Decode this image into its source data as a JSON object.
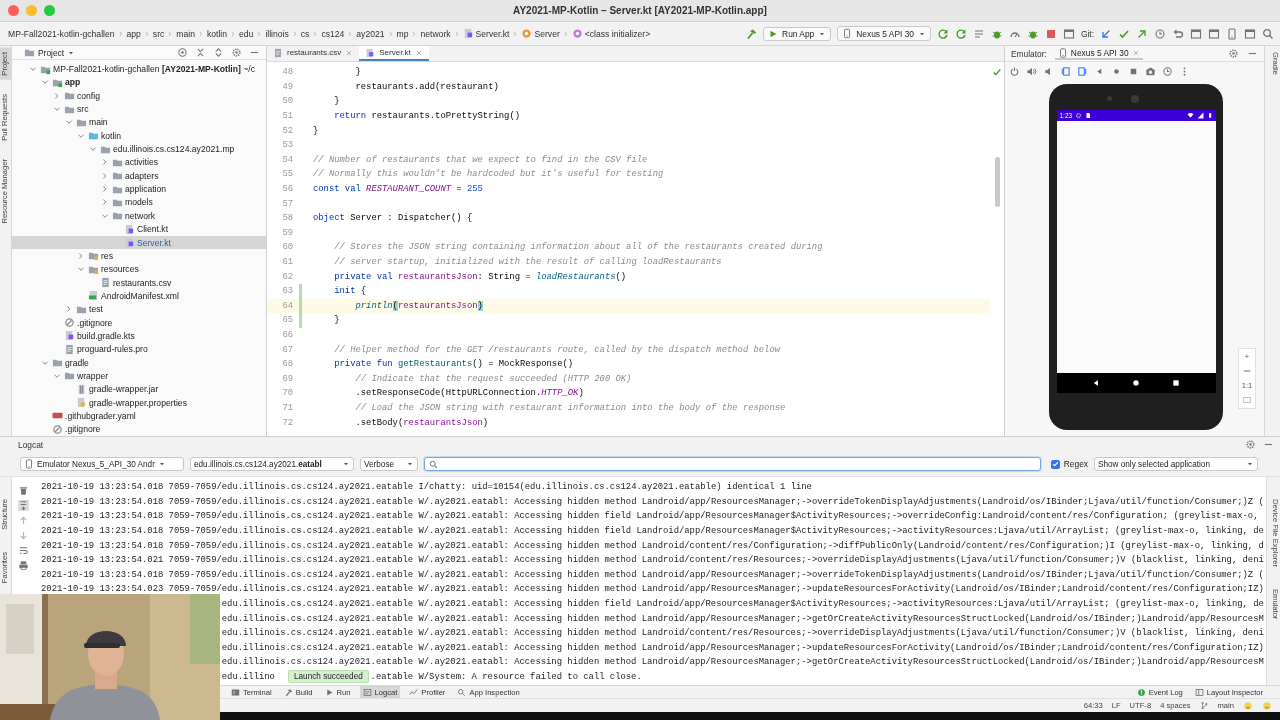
{
  "window": {
    "title": "AY2021-MP-Kotlin – Server.kt [AY2021-MP-Kotlin.app]"
  },
  "breadcrumbs": [
    {
      "label": "MP-Fall2021-kotlin-gchallen",
      "kind": "folder"
    },
    {
      "label": "app",
      "kind": "folder"
    },
    {
      "label": "src",
      "kind": "folder"
    },
    {
      "label": "main",
      "kind": "folder"
    },
    {
      "label": "kotlin",
      "kind": "folder"
    },
    {
      "label": "edu",
      "kind": "folder"
    },
    {
      "label": "illinois",
      "kind": "folder"
    },
    {
      "label": "cs",
      "kind": "folder"
    },
    {
      "label": "cs124",
      "kind": "folder"
    },
    {
      "label": "ay2021",
      "kind": "folder"
    },
    {
      "label": "mp",
      "kind": "folder"
    },
    {
      "label": "network",
      "kind": "folder"
    },
    {
      "label": "Server.kt",
      "kind": "file"
    },
    {
      "label": "Server",
      "kind": "class"
    },
    {
      "label": "<class initializer>",
      "kind": "method"
    }
  ],
  "toolbar": {
    "run_config": "Run App",
    "device": "Nexus 5 API 30",
    "git_label": "Git:"
  },
  "left_strip": [
    {
      "label": "Project",
      "selected": true
    },
    {
      "label": "Pull Requests",
      "selected": false
    },
    {
      "label": "Resource Manager",
      "selected": false
    }
  ],
  "project": {
    "view": "Project",
    "tree": [
      {
        "label": "MP-Fall2021-kotlin-gchallen **[AY2021-MP-Kotlin]** ~/c",
        "kind": "module",
        "expanded": true,
        "selected": false,
        "children": [
          {
            "label": "app",
            "kind": "module",
            "expanded": true,
            "selected": false,
            "children": [
              {
                "label": "config",
                "kind": "folder",
                "expanded": false,
                "selected": false
              },
              {
                "label": "src",
                "kind": "folder",
                "expanded": true,
                "selected": false,
                "children": [
                  {
                    "label": "main",
                    "kind": "folder",
                    "expanded": true,
                    "selected": false,
                    "children": [
                      {
                        "label": "kotlin",
                        "kind": "source",
                        "expanded": true,
                        "selected": false,
                        "children": [
                          {
                            "label": "edu.illinois.cs.cs124.ay2021.mp",
                            "kind": "folder",
                            "expanded": true,
                            "selected": false,
                            "children": [
                              {
                                "label": "activities",
                                "kind": "folder",
                                "expanded": false,
                                "selected": false
                              },
                              {
                                "label": "adapters",
                                "kind": "folder",
                                "expanded": false,
                                "selected": false
                              },
                              {
                                "label": "application",
                                "kind": "folder",
                                "expanded": false,
                                "selected": false
                              },
                              {
                                "label": "models",
                                "kind": "folder",
                                "expanded": false,
                                "selected": false
                              },
                              {
                                "label": "network",
                                "kind": "folder",
                                "expanded": true,
                                "selected": false,
                                "children": [
                                  {
                                    "label": "Client.kt",
                                    "kind": "kotlin",
                                    "selected": false
                                  },
                                  {
                                    "label": "Server.kt",
                                    "kind": "kotlin",
                                    "selected": true
                                  }
                                ]
                              }
                            ]
                          }
                        ]
                      },
                      {
                        "label": "res",
                        "kind": "resfolder",
                        "expanded": false,
                        "selected": false
                      },
                      {
                        "label": "resources",
                        "kind": "resfolder",
                        "expanded": true,
                        "selected": false,
                        "children": [
                          {
                            "label": "restaurants.csv",
                            "kind": "text",
                            "selected": false
                          }
                        ]
                      },
                      {
                        "label": "AndroidManifest.xml",
                        "kind": "manifest",
                        "selected": false
                      }
                    ]
                  },
                  {
                    "label": "test",
                    "kind": "folder",
                    "expanded": false,
                    "selected": false
                  }
                ]
              },
              {
                "label": ".gitignore",
                "kind": "ignore",
                "selected": false
              },
              {
                "label": "build.gradle.kts",
                "kind": "kotlin",
                "selected": false
              },
              {
                "label": "proguard-rules.pro",
                "kind": "text",
                "selected": false
              }
            ]
          },
          {
            "label": "gradle",
            "kind": "folder",
            "expanded": true,
            "selected": false,
            "children": [
              {
                "label": "wrapper",
                "kind": "folder",
                "expanded": true,
                "selected": false,
                "children": [
                  {
                    "label": "gradle-wrapper.jar",
                    "kind": "jar",
                    "selected": false
                  },
                  {
                    "label": "gradle-wrapper.properties",
                    "kind": "properties",
                    "selected": false
                  }
                ]
              }
            ]
          },
          {
            "label": ".githubgrader.yaml",
            "kind": "yaml",
            "selected": false
          },
          {
            "label": ".gitignore",
            "kind": "ignore",
            "selected": false
          }
        ]
      }
    ]
  },
  "editor": {
    "tabs": [
      {
        "label": "restaurants.csv",
        "kind": "text",
        "selected": false
      },
      {
        "label": "Server.kt",
        "kind": "kotlin",
        "selected": true
      }
    ],
    "lines": [
      {
        "n": "48",
        "code": [
          {
            "kind": "plain",
            "text": "        }"
          }
        ],
        "current": false,
        "changed": false
      },
      {
        "n": "49",
        "code": [
          {
            "kind": "plain",
            "text": "        restaurants.add(restaurant)"
          }
        ],
        "current": false,
        "changed": false
      },
      {
        "n": "50",
        "code": [
          {
            "kind": "plain",
            "text": "    }"
          }
        ],
        "current": false,
        "changed": false
      },
      {
        "n": "51",
        "code": [
          {
            "kind": "keyword",
            "text": "    return "
          },
          {
            "kind": "plain",
            "text": "restaurants.toPrettyString()"
          }
        ],
        "current": false,
        "changed": false
      },
      {
        "n": "52",
        "code": [
          {
            "kind": "plain",
            "text": "}"
          }
        ],
        "current": false,
        "changed": false
      },
      {
        "n": "53",
        "current": false,
        "changed": false
      },
      {
        "n": "54",
        "code": [
          {
            "kind": "comment",
            "text": "// Number of restaurants that we expect to find in the CSV file"
          }
        ],
        "current": false,
        "changed": false
      },
      {
        "n": "55",
        "code": [
          {
            "kind": "comment",
            "text": "// Normally this wouldn't be hardcoded but it's useful for testing"
          }
        ],
        "current": false,
        "changed": false
      },
      {
        "n": "56",
        "code": [
          {
            "kind": "keyword",
            "text": "const val "
          },
          {
            "kind": "constant",
            "text": "RESTAURANT_COUNT"
          },
          {
            "kind": "plain",
            "text": " = "
          },
          {
            "kind": "number",
            "text": "255"
          }
        ],
        "current": false,
        "changed": false
      },
      {
        "n": "57",
        "current": false,
        "changed": false
      },
      {
        "n": "58",
        "code": [
          {
            "kind": "keyword",
            "text": "object "
          },
          {
            "kind": "plain",
            "text": "Server : Dispatcher() {"
          }
        ],
        "current": false,
        "changed": false
      },
      {
        "n": "59",
        "current": false,
        "changed": false
      },
      {
        "n": "60",
        "code": [
          {
            "kind": "comment",
            "text": "    // Stores the JSON string containing information about all of the restaurants created during"
          }
        ],
        "current": false,
        "changed": false
      },
      {
        "n": "61",
        "code": [
          {
            "kind": "comment",
            "text": "    // server startup, initialized with the result of calling loadRestaurants"
          }
        ],
        "current": false,
        "changed": false
      },
      {
        "n": "62",
        "code": [
          {
            "kind": "keyword",
            "text": "    private val "
          },
          {
            "kind": "property",
            "text": "restaurantsJson"
          },
          {
            "kind": "plain",
            "text": ": String = "
          },
          {
            "kind": "call",
            "text": "loadRestaurants"
          },
          {
            "kind": "plain",
            "text": "()"
          }
        ],
        "current": false,
        "changed": false
      },
      {
        "n": "63",
        "code": [
          {
            "kind": "keyword",
            "text": "    init "
          },
          {
            "kind": "plain",
            "text": "{"
          }
        ],
        "current": false,
        "changed": true
      },
      {
        "n": "64",
        "code": [
          {
            "kind": "call",
            "text": "        println"
          },
          {
            "kind": "match",
            "text": "("
          },
          {
            "kind": "property",
            "text": "restaurantsJson"
          },
          {
            "kind": "match",
            "text": ")"
          }
        ],
        "current": true,
        "changed": true
      },
      {
        "n": "65",
        "code": [
          {
            "kind": "plain",
            "text": "    }"
          }
        ],
        "current": false,
        "changed": true
      },
      {
        "n": "66",
        "current": false,
        "changed": false
      },
      {
        "n": "67",
        "code": [
          {
            "kind": "comment",
            "text": "    // Helper method for the GET /restaurants route, called by the dispatch method below"
          }
        ],
        "current": false,
        "changed": false
      },
      {
        "n": "68",
        "code": [
          {
            "kind": "keyword",
            "text": "    private fun "
          },
          {
            "kind": "declaration",
            "text": "getRestaurants"
          },
          {
            "kind": "plain",
            "text": "() = MockResponse()"
          }
        ],
        "current": false,
        "changed": false
      },
      {
        "n": "69",
        "code": [
          {
            "kind": "comment",
            "text": "        // Indicate that the request succeeded (HTTP 200 OK)"
          }
        ],
        "current": false,
        "changed": false
      },
      {
        "n": "70",
        "code": [
          {
            "kind": "plain",
            "text": "        .setResponseCode(HttpURLConnection."
          },
          {
            "kind": "constant",
            "text": "HTTP_OK"
          },
          {
            "kind": "plain",
            "text": ")"
          }
        ],
        "current": false,
        "changed": false
      },
      {
        "n": "71",
        "code": [
          {
            "kind": "comment",
            "text": "        // Load the JSON string with restaurant information into the body of the response"
          }
        ],
        "current": false,
        "changed": false
      },
      {
        "n": "72",
        "code": [
          {
            "kind": "plain",
            "text": "        .setBody("
          },
          {
            "kind": "property",
            "text": "restaurantsJson"
          },
          {
            "kind": "plain",
            "text": ")"
          }
        ],
        "current": false,
        "changed": false
      }
    ]
  },
  "emulator": {
    "label": "Emulator:",
    "tab": "Nexus 5 API 30",
    "clock": "1:23",
    "zoom_in": "+",
    "zoom_reset": "1:1"
  },
  "right_strip": [
    "Gradle"
  ],
  "logcat": {
    "title": "Logcat",
    "device": "Emulator Nexus_5_API_30 Andr",
    "process": "edu.illinois.cs.cs124.ay2021.**eatabl**",
    "level": "Verbose",
    "regex": {
      "label": "Regex",
      "checked": true
    },
    "filter": "Show only selected application",
    "lines": [
      {
        "kind": "full",
        "text": "2021-10-19 13:23:54.018 7059-7059/edu.illinois.cs.cs124.ay2021.eatable I/chatty: uid=10154(edu.illinois.cs.cs124.ay2021.eatable) identical 1 line"
      },
      {
        "kind": "full",
        "text": "2021-10-19 13:23:54.018 7059-7059/edu.illinois.cs.cs124.ay2021.eatable W/.ay2021.eatabl: Accessing hidden method Landroid/app/ResourcesManager;->overrideTokenDisplayAdjustments(Landroid/os/IBinder;Ljava/util/function/Consumer;)Z ("
      },
      {
        "kind": "full",
        "text": "2021-10-19 13:23:54.018 7059-7059/edu.illinois.cs.cs124.ay2021.eatable W/.ay2021.eatabl: Accessing hidden field Landroid/app/ResourcesManager$ActivityResources;->overrideConfig:Landroid/content/res/Configuration; (greylist-max-o,"
      },
      {
        "kind": "full",
        "text": "2021-10-19 13:23:54.018 7059-7059/edu.illinois.cs.cs124.ay2021.eatable W/.ay2021.eatabl: Accessing hidden field Landroid/app/ResourcesManager$ActivityResources;->activityResources:Ljava/util/ArrayList; (greylist-max-o, linking, de"
      },
      {
        "kind": "full",
        "text": "2021-10-19 13:23:54.018 7059-7059/edu.illinois.cs.cs124.ay2021.eatable W/.ay2021.eatabl: Accessing hidden method Landroid/content/res/Configuration;->diffPublicOnly(Landroid/content/res/Configuration;)I (greylist-max-o, linking, d"
      },
      {
        "kind": "full",
        "text": "2021-10-19 13:23:54.021 7059-7059/edu.illinois.cs.cs124.ay2021.eatable W/.ay2021.eatabl: Accessing hidden method Landroid/content/res/Resources;->overrideDisplayAdjustments(Ljava/util/function/Consumer;)V (blacklist, linking, deni"
      },
      {
        "kind": "full",
        "text": "2021-10-19 13:23:54.018 7059-7059/edu.illinois.cs.cs124.ay2021.eatable W/.ay2021.eatabl: Accessing hidden method Landroid/app/ResourcesManager;->overrideTokenDisplayAdjustments(Landroid/os/IBinder;Ljava/util/function/Consumer;)Z ("
      },
      {
        "kind": "full",
        "text": "2021-10-19 13:23:54.023 7059-7059/edu.illinois.cs.cs124.ay2021.eatable W/.ay2021.eatabl: Accessing hidden method Landroid/app/ResourcesManager;->updateResourcesForActivity(Landroid/os/IBinder;Landroid/content/res/Configuration;IZ)"
      },
      {
        "kind": "cut",
        "text": "edu.illinois.cs.cs124.ay2021.eatable W/.ay2021.eatabl: Accessing hidden field Landroid/app/ResourcesManager$ActivityResources;->activityResources:Ljava/util/ArrayList; (greylist-max-o, linking, de"
      },
      {
        "kind": "cut",
        "text": "edu.illinois.cs.cs124.ay2021.eatable W/.ay2021.eatabl: Accessing hidden method Landroid/app/ResourcesManager;->getOrCreateActivityResourcesStructLocked(Landroid/os/IBinder;)Landroid/app/ResourcesM"
      },
      {
        "kind": "cut",
        "text": "edu.illinois.cs.cs124.ay2021.eatable W/.ay2021.eatabl: Accessing hidden method Landroid/content/res/Resources;->overrideDisplayAdjustments(Ljava/util/function/Consumer;)V (blacklist, linking, deni"
      },
      {
        "kind": "cut",
        "text": "edu.illinois.cs.cs124.ay2021.eatable W/.ay2021.eatabl: Accessing hidden method Landroid/app/ResourcesManager;->updateResourcesForActivity(Landroid/os/IBinder;Landroid/content/res/Configuration;IZ)"
      },
      {
        "kind": "cut",
        "text": "edu.illinois.cs.cs124.ay2021.eatable W/.ay2021.eatabl: Accessing hidden method Landroid/app/ResourcesManager;->getOrCreateActivityResourcesStructLocked(Landroid/os/IBinder;)Landroid/app/ResourcesM"
      },
      {
        "kind": "cut",
        "text": "edu.illino",
        "tail": ".eatable W/System: A resource failed to call close."
      }
    ],
    "toast": "Launch succeeded"
  },
  "bottom_left_strip": [
    "Structure",
    "Favorites"
  ],
  "bottom_right_strip": [
    "Device File Explorer",
    "Emulator"
  ],
  "tool_tabs": [
    {
      "label": "Terminal",
      "selected": false
    },
    {
      "label": "Build",
      "selected": false
    },
    {
      "label": "Run",
      "selected": false
    },
    {
      "label": "Logcat",
      "selected": true
    },
    {
      "label": "Profiler",
      "selected": false
    },
    {
      "label": "App Inspection",
      "selected": false
    }
  ],
  "tool_tabs_right": [
    "Event Log",
    "Layout Inspector"
  ],
  "status_bar": [
    "64:33",
    "LF",
    "UTF-8",
    "4 spaces",
    "main"
  ]
}
